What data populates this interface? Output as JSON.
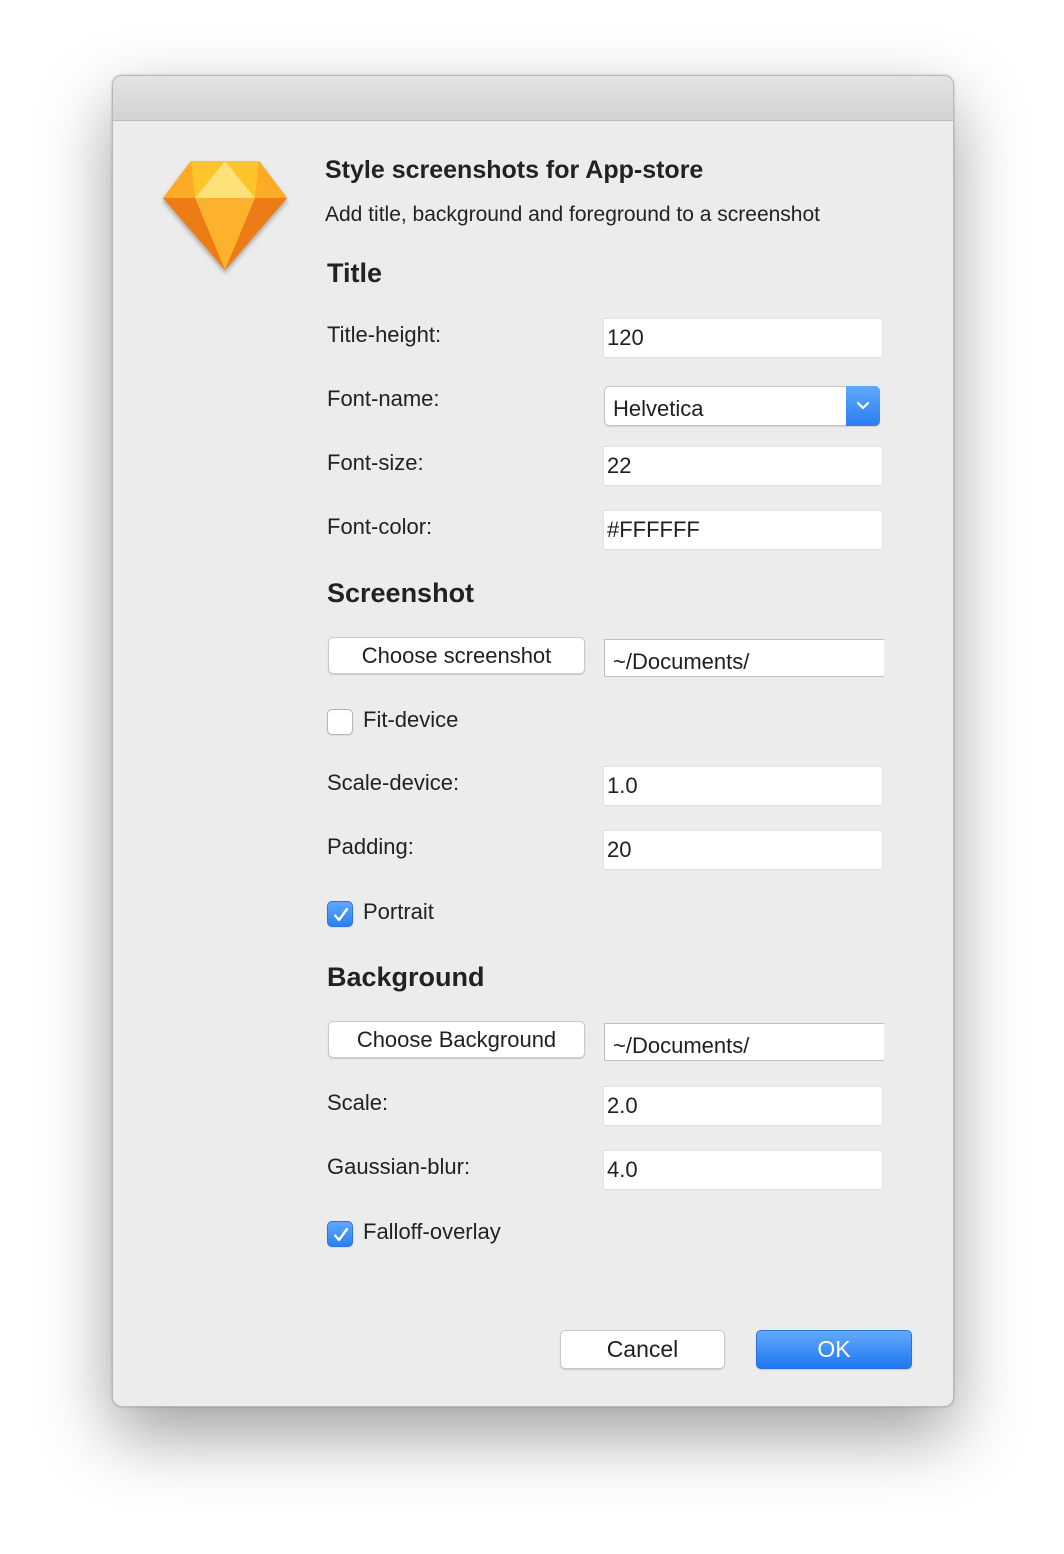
{
  "dialog": {
    "heading": "Style screenshots for App-store",
    "subheading": "Add title, background and foreground to a screenshot",
    "icon": "sketch-diamond-icon"
  },
  "title_section": {
    "title": "Title",
    "title_height_label": "Title-height:",
    "title_height_value": "120",
    "font_name_label": "Font-name:",
    "font_name_value": "Helvetica",
    "font_size_label": "Font-size:",
    "font_size_value": "22",
    "font_color_label": "Font-color:",
    "font_color_value": "#FFFFFF"
  },
  "screenshot_section": {
    "title": "Screenshot",
    "choose_button": "Choose screenshot",
    "path": "~/Documents/",
    "fit_device_label": "Fit-device",
    "fit_device_checked": false,
    "scale_device_label": "Scale-device:",
    "scale_device_value": "1.0",
    "padding_label": "Padding:",
    "padding_value": "20",
    "portrait_label": "Portrait",
    "portrait_checked": true
  },
  "background_section": {
    "title": "Background",
    "choose_button": "Choose Background",
    "path": "~/Documents/",
    "scale_label": "Scale:",
    "scale_value": "2.0",
    "blur_label": "Gaussian-blur:",
    "blur_value": "4.0",
    "falloff_label": "Falloff-overlay",
    "falloff_checked": true
  },
  "footer": {
    "cancel_label": "Cancel",
    "ok_label": "OK"
  },
  "colors": {
    "accent": "#2b7ef2",
    "window_bg": "#ececec",
    "gem_orange": "#f7931e",
    "gem_yellow": "#fdd231"
  }
}
